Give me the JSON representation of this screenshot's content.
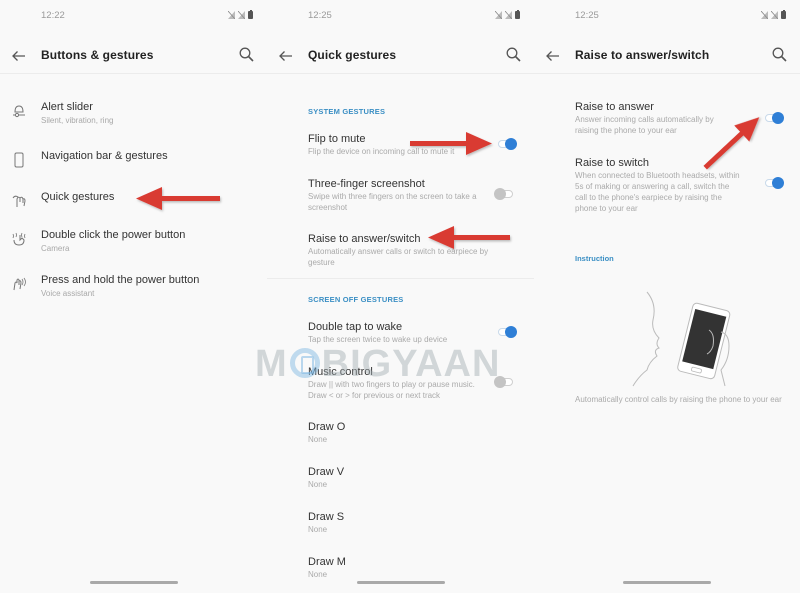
{
  "screens": [
    {
      "status": {
        "time": "12:22"
      },
      "title": "Buttons & gestures",
      "items": [
        {
          "label": "Alert slider",
          "subtitle": "Silent, vibration, ring",
          "icon": "alert-slider-icon"
        },
        {
          "label": "Navigation bar & gestures",
          "subtitle": "",
          "icon": "phone-outline-icon"
        },
        {
          "label": "Quick gestures",
          "subtitle": "",
          "icon": "gesture-hand-icon"
        },
        {
          "label": "Double click the power button",
          "subtitle": "Camera",
          "icon": "double-tap-hand-icon"
        },
        {
          "label": "Press and hold the power button",
          "subtitle": "Voice assistant",
          "icon": "press-hold-hand-icon"
        }
      ]
    },
    {
      "status": {
        "time": "12:25"
      },
      "title": "Quick gestures",
      "sections": [
        {
          "header": "SYSTEM GESTURES",
          "items": [
            {
              "label": "Flip to mute",
              "subtitle": "Flip the device on incoming call to mute it",
              "toggle": true
            },
            {
              "label": "Three-finger screenshot",
              "subtitle": "Swipe with three fingers on the screen to take a screenshot",
              "toggle": false
            },
            {
              "label": "Raise to answer/switch",
              "subtitle": "Automatically answer calls or switch to earpiece by gesture",
              "toggle": null
            }
          ]
        },
        {
          "header": "SCREEN OFF GESTURES",
          "items": [
            {
              "label": "Double tap to wake",
              "subtitle": "Tap the screen twice to wake up device",
              "toggle": true
            },
            {
              "label": "Music control",
              "subtitle": "Draw || with two fingers to play or pause music. Draw < or > for previous or next track",
              "toggle": false
            },
            {
              "label": "Draw O",
              "subtitle": "None",
              "toggle": null
            },
            {
              "label": "Draw V",
              "subtitle": "None",
              "toggle": null
            },
            {
              "label": "Draw S",
              "subtitle": "None",
              "toggle": null
            },
            {
              "label": "Draw M",
              "subtitle": "None",
              "toggle": null
            }
          ]
        }
      ]
    },
    {
      "status": {
        "time": "12:25"
      },
      "title": "Raise to answer/switch",
      "items": [
        {
          "label": "Raise to answer",
          "subtitle": "Answer incoming calls automatically by raising the phone to your ear",
          "toggle": true
        },
        {
          "label": "Raise to switch",
          "subtitle": "When connected to Bluetooth headsets, within 5s of making or answering a call, switch the call to the phone's earpiece by raising the phone to your ear",
          "toggle": true
        }
      ],
      "instruction": {
        "header": "Instruction",
        "caption": "Automatically control calls by raising the phone to your ear"
      }
    }
  ],
  "watermark": {
    "left": "M",
    "right": "BIGYAAN"
  },
  "colors": {
    "accent": "#2f7fd6",
    "section_header": "#3b8fc4",
    "annotation_arrow": "#d93a33"
  }
}
